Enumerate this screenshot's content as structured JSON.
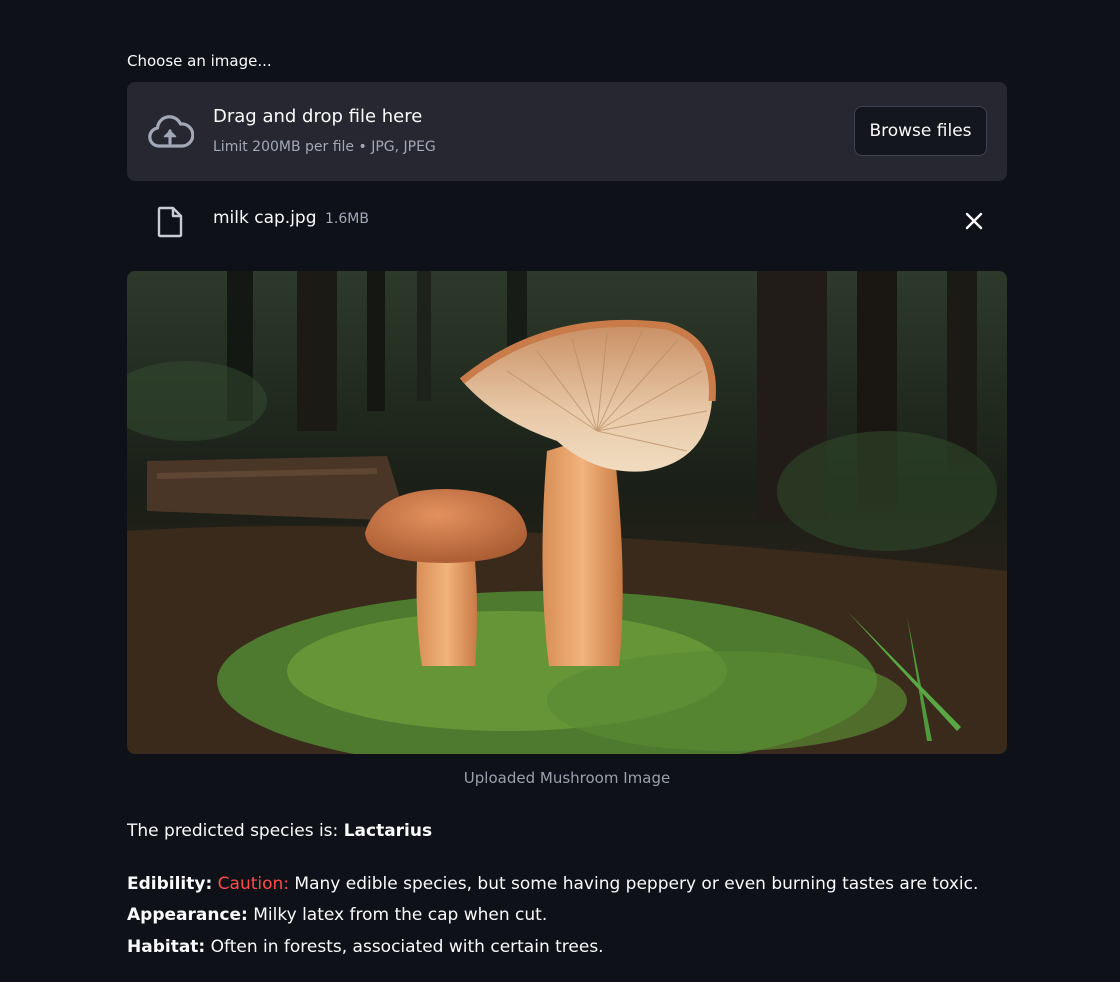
{
  "uploader": {
    "label": "Choose an image...",
    "drop_title": "Drag and drop file here",
    "limit_text": "Limit 200MB per file • JPG, JPEG",
    "browse_label": "Browse files",
    "cloud_icon": "cloud-upload-icon"
  },
  "file": {
    "name": "milk cap.jpg",
    "size": "1.6MB",
    "icon": "file-icon",
    "remove_icon": "close-icon"
  },
  "image": {
    "caption": "Uploaded Mushroom Image"
  },
  "result": {
    "prediction_prefix": "The predicted species is: ",
    "species": "Lactarius",
    "edibility_label": "Edibility:",
    "edibility_status": "Caution:",
    "edibility_text": " Many edible species, but some having peppery or even burning tastes are toxic.",
    "appearance_label": "Appearance:",
    "appearance_text": " Milky latex from the cap when cut.",
    "habitat_label": "Habitat:",
    "habitat_text": " Often in forests, associated with certain trees."
  },
  "colors": {
    "background": "#0e1117",
    "dropzone": "#262730",
    "caution": "#ff4b4b"
  }
}
